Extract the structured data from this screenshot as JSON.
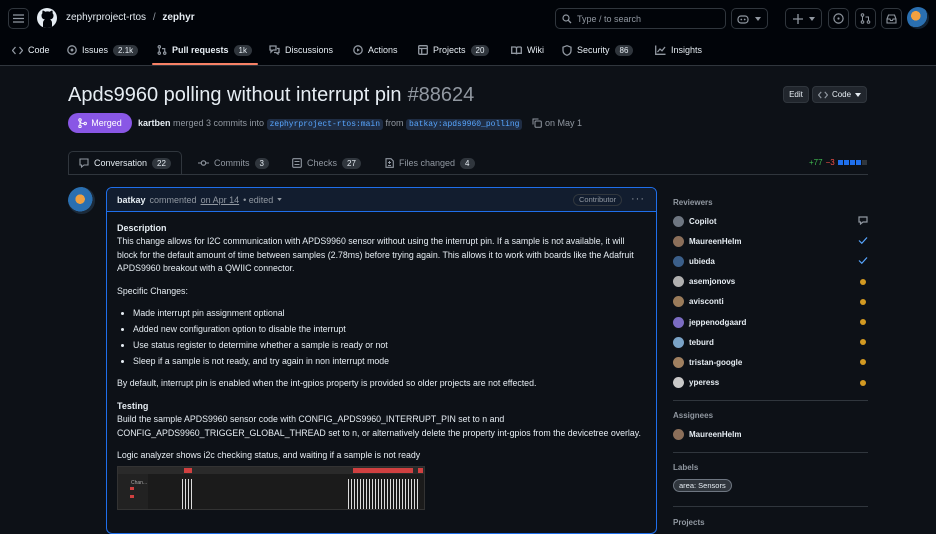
{
  "header": {
    "owner": "zephyrproject-rtos",
    "slash": "/",
    "repo": "zephyr",
    "search_placeholder": "Type / to search",
    "search_key": "/"
  },
  "repo_nav": [
    {
      "label": "Code",
      "icon": "code-icon",
      "count": null
    },
    {
      "label": "Issues",
      "icon": "issue-icon",
      "count": "2.1k"
    },
    {
      "label": "Pull requests",
      "icon": "pull-request-icon",
      "count": "1k"
    },
    {
      "label": "Discussions",
      "icon": "discussion-icon",
      "count": null
    },
    {
      "label": "Actions",
      "icon": "play-icon",
      "count": null
    },
    {
      "label": "Projects",
      "icon": "table-icon",
      "count": "20"
    },
    {
      "label": "Wiki",
      "icon": "book-icon",
      "count": null
    },
    {
      "label": "Security",
      "icon": "shield-icon",
      "count": "86"
    },
    {
      "label": "Insights",
      "icon": "graph-icon",
      "count": null
    }
  ],
  "pr": {
    "title": "Apds9960 polling without interrupt pin",
    "number": "#88624",
    "edit_label": "Edit",
    "code_label": "Code",
    "state": "Merged",
    "author": "kartben",
    "merge_text": "merged 3 commits into",
    "base_branch": "zephyrproject-rtos:main",
    "from_text": "from",
    "head_branch": "batkay:apds9960_polling",
    "date_text": "on May 1"
  },
  "pr_tabs": [
    {
      "label": "Conversation",
      "count": "22"
    },
    {
      "label": "Commits",
      "count": "3"
    },
    {
      "label": "Checks",
      "count": "27"
    },
    {
      "label": "Files changed",
      "count": "4"
    }
  ],
  "diffstat": {
    "added": "+77",
    "removed": "−3"
  },
  "comment": {
    "author": "batkay",
    "action": "commented",
    "date": "on Apr 14",
    "edited": "• edited",
    "badge": "Contributor",
    "menu": "···",
    "h_description": "Description",
    "p_description": "This change allows for I2C communication with APDS9960 sensor without using the interrupt pin. If a sample is not available, it will block for the default amount of time between samples (2.78ms) before trying again. This allows it to work with boards like the Adafruit APDS9960 breakout with a QWIIC connector.",
    "p_specific": "Specific Changes:",
    "changes": [
      "Made interrupt pin assignment optional",
      "Added new configuration option to disable the interrupt",
      "Use status register to determine whether a sample is ready or not",
      "Sleep if a sample is not ready, and try again in non interrupt mode"
    ],
    "p_default": "By default, interrupt pin is enabled when the int-gpios property is provided so older projects are not effected.",
    "h_testing": "Testing",
    "p_testing": "Build the sample APDS9960 sensor code with CONFIG_APDS9960_INTERRUPT_PIN set to n and CONFIG_APDS9960_TRIGGER_GLOBAL_THREAD set to n, or alternatively delete the property int-gpios from the devicetree overlay.",
    "p_logic": "Logic analyzer shows i2c checking status, and waiting if a sample is not ready",
    "image_label": "Chan..."
  },
  "sidebar": {
    "reviewers_title": "Reviewers",
    "reviewers": [
      {
        "name": "Copilot",
        "status": "comment-icon",
        "color": "#6e7681"
      },
      {
        "name": "MaureenHelm",
        "status": "check-icon",
        "color": "#8b6f5a"
      },
      {
        "name": "ubieda",
        "status": "check-icon",
        "color": "#3b5f8a"
      },
      {
        "name": "asemjonovs",
        "status": "pending",
        "color": "#b0b0b0"
      },
      {
        "name": "avisconti",
        "status": "pending",
        "color": "#9a7b5a"
      },
      {
        "name": "jeppenodgaard",
        "status": "pending",
        "color": "#7b6cc2"
      },
      {
        "name": "teburd",
        "status": "pending",
        "color": "#7aa3c7"
      },
      {
        "name": "tristan-google",
        "status": "pending",
        "color": "#a08060"
      },
      {
        "name": "yperess",
        "status": "pending",
        "color": "#c9c9c9"
      }
    ],
    "assignees_title": "Assignees",
    "assignee": "MaureenHelm",
    "labels_title": "Labels",
    "label": "area: Sensors",
    "projects_title": "Projects"
  },
  "colors": {
    "accent": "#1f6feb",
    "merged": "#8957e5",
    "pending": "#d29922",
    "add": "#3fb950",
    "del": "#f85149"
  }
}
